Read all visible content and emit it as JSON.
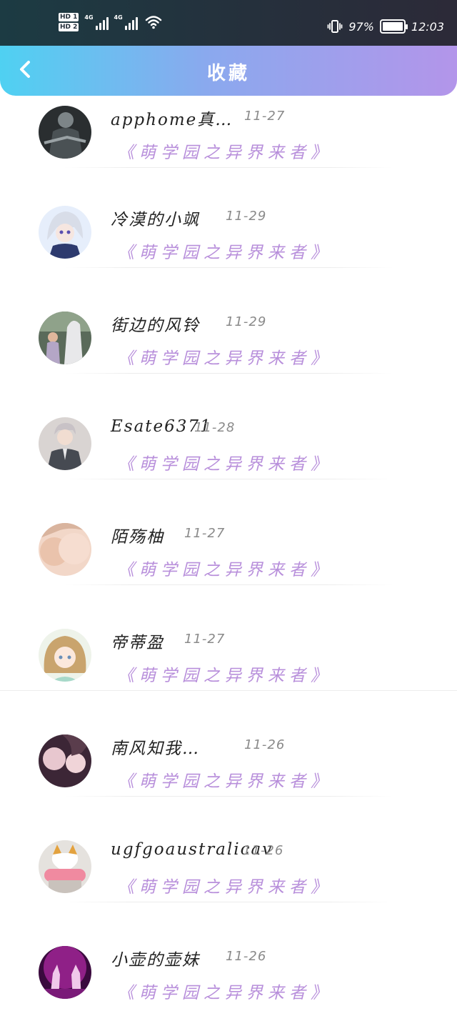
{
  "status_bar": {
    "hd1": "HD 1",
    "hd2": "HD 2",
    "net1": "4G",
    "net2": "4G",
    "battery": "97%",
    "time": "12:03"
  },
  "header": {
    "back_icon": "chevron-left-icon",
    "title": "收藏"
  },
  "colors": {
    "header_start": "#4fd1f2",
    "header_end": "#b395ea",
    "book_title": "#b88fdb",
    "date": "#8a8a8a"
  },
  "favorites": [
    {
      "user": "apphome真…",
      "date": "11-27",
      "book": "《萌学园之异界来者》"
    },
    {
      "user": "冷漠的小飒",
      "date": "11-29",
      "book": "《萌学园之异界来者》"
    },
    {
      "user": "街边的风铃",
      "date": "11-29",
      "book": "《萌学园之异界来者》"
    },
    {
      "user": "Esate6371",
      "date": "11-28",
      "book": "《萌学园之异界来者》"
    },
    {
      "user": "陌殇柚",
      "date": "11-27",
      "book": "《萌学园之异界来者》"
    },
    {
      "user": "帝蒂盈",
      "date": "11-27",
      "book": "《萌学园之异界来者》"
    },
    {
      "user": "南风知我…",
      "date": "11-26",
      "book": "《萌学园之异界来者》"
    },
    {
      "user": "ugfgoaustralicav",
      "date": "11-26",
      "book": "《萌学园之异界来者》"
    },
    {
      "user": "小壶的壶妹",
      "date": "11-26",
      "book": "《萌学园之异界来者》"
    }
  ]
}
